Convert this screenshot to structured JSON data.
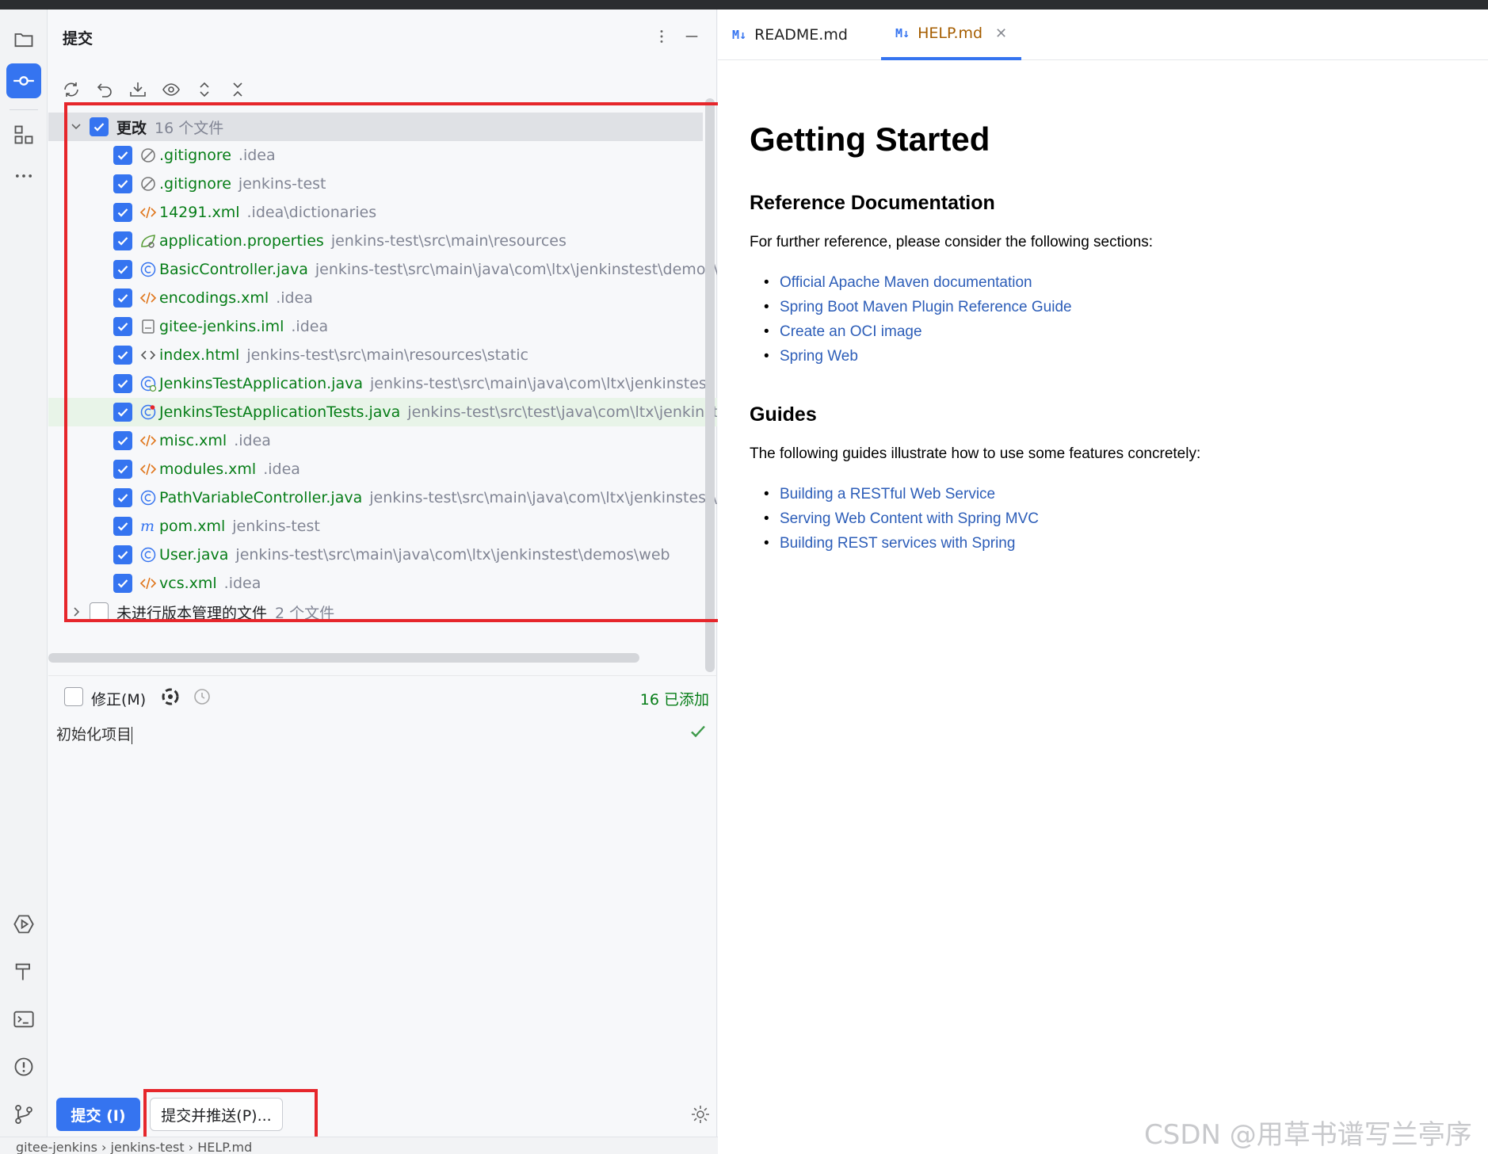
{
  "panel": {
    "title": "提交"
  },
  "changes_group": {
    "name": "更改",
    "count": "16 个文件"
  },
  "files": [
    {
      "name": ".gitignore",
      "path": ".idea",
      "icon": "ignore-icon"
    },
    {
      "name": ".gitignore",
      "path": "jenkins-test",
      "icon": "ignore-icon"
    },
    {
      "name": "14291.xml",
      "path": ".idea\\dictionaries",
      "icon": "xml-icon"
    },
    {
      "name": "application.properties",
      "path": "jenkins-test\\src\\main\\resources",
      "icon": "properties-icon"
    },
    {
      "name": "BasicController.java",
      "path": "jenkins-test\\src\\main\\java\\com\\ltx\\jenkinstest\\demos\\web",
      "icon": "java-class-icon"
    },
    {
      "name": "encodings.xml",
      "path": ".idea",
      "icon": "xml-icon"
    },
    {
      "name": "gitee-jenkins.iml",
      "path": ".idea",
      "icon": "iml-icon"
    },
    {
      "name": "index.html",
      "path": "jenkins-test\\src\\main\\resources\\static",
      "icon": "html-icon"
    },
    {
      "name": "JenkinsTestApplication.java",
      "path": "jenkins-test\\src\\main\\java\\com\\ltx\\jenkinstest",
      "icon": "spring-class-icon"
    },
    {
      "name": "JenkinsTestApplicationTests.java",
      "path": "jenkins-test\\src\\test\\java\\com\\ltx\\jenkinstest",
      "icon": "test-class-icon"
    },
    {
      "name": "misc.xml",
      "path": ".idea",
      "icon": "xml-icon"
    },
    {
      "name": "modules.xml",
      "path": ".idea",
      "icon": "xml-icon"
    },
    {
      "name": "PathVariableController.java",
      "path": "jenkins-test\\src\\main\\java\\com\\ltx\\jenkinstest\\demos",
      "icon": "java-class-icon"
    },
    {
      "name": "pom.xml",
      "path": "jenkins-test",
      "icon": "maven-icon"
    },
    {
      "name": "User.java",
      "path": "jenkins-test\\src\\main\\java\\com\\ltx\\jenkinstest\\demos\\web",
      "icon": "java-class-icon"
    },
    {
      "name": "vcs.xml",
      "path": ".idea",
      "icon": "xml-icon"
    }
  ],
  "unversioned_group": {
    "name": "未进行版本管理的文件",
    "count": "2 个文件"
  },
  "amend": {
    "label": "修正(M)",
    "added": "16 已添加"
  },
  "commit_message": "初始化项目",
  "buttons": {
    "commit": "提交 (I)",
    "commit_push": "提交并推送(P)..."
  },
  "tabs": [
    {
      "label": "README.md",
      "active": false
    },
    {
      "label": "HELP.md",
      "active": true
    }
  ],
  "doc": {
    "h1": "Getting Started",
    "ref_heading": "Reference Documentation",
    "ref_intro": "For further reference, please consider the following sections:",
    "ref_links": [
      "Official Apache Maven documentation",
      "Spring Boot Maven Plugin Reference Guide",
      "Create an OCI image",
      "Spring Web"
    ],
    "guides_heading": "Guides",
    "guides_intro": "The following guides illustrate how to use some features concretely:",
    "guide_links": [
      "Building a RESTful Web Service",
      "Serving Web Content with Spring MVC",
      "Building REST services with Spring"
    ]
  },
  "statusbar": {
    "crumbs": [
      "gitee-jenkins",
      "jenkins-test",
      "HELP.md"
    ]
  },
  "watermark": "CSDN @用草书谱写兰亭序",
  "colors": {
    "accent": "#3574f0",
    "added_green": "#067d17",
    "annotation_red": "#e6262b",
    "link_blue": "#2c5db8"
  }
}
